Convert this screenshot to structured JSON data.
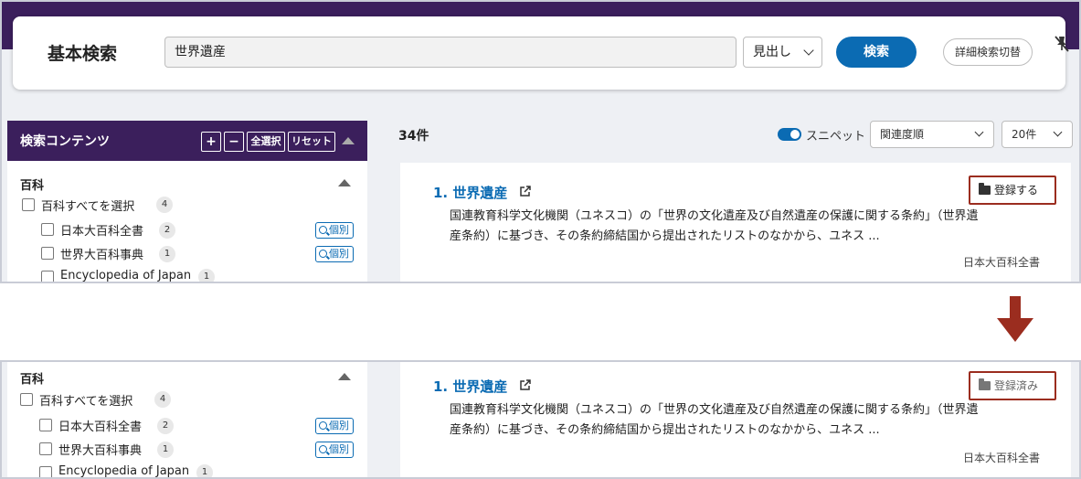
{
  "search": {
    "title": "基本検索",
    "query": "世界遺産",
    "mode": "見出し",
    "submit_label": "検索",
    "advanced_toggle_label": "詳細検索切替"
  },
  "sidebar": {
    "title": "検索コンテンツ",
    "plus_label": "+",
    "minus_label": "−",
    "select_all_label": "全選択",
    "reset_label": "リセット",
    "section_title": "百科",
    "select_all_item": {
      "label": "百科すべてを選択",
      "count": "4"
    },
    "items": [
      {
        "label": "日本大百科全書",
        "count": "2",
        "button": "個別"
      },
      {
        "label": "世界大百科事典",
        "count": "1",
        "button": "個別"
      },
      {
        "label": "Encyclopedia of Japan",
        "count": "1"
      }
    ]
  },
  "results": {
    "count_label": "34件",
    "snippet_toggle_label": "スニペット",
    "sort_value": "関連度順",
    "per_page_value": "20件"
  },
  "result_item": {
    "title": "1. 世界遺産",
    "snippet_line1": "国連教育科学文化機関（ユネスコ）の「世界の文化遺産及び自然遺産の保護に関する条約」（世界遺",
    "snippet_line2": "産条約）に基づき、その条約締結国から提出されたリストのなかから、ユネス ...",
    "snippet2_line1": "国連教育科学文化機関（ユネスコ）の「世界の文化遺産及び自然遺産の保護に関する条約」（世界遺",
    "snippet2_line2": "産条約）に基づき、その条約締結国から提出されたリストのなかから、ユネス ...",
    "source": "日本大百科全書",
    "register_label": "登録する",
    "registered_label": "登録済み"
  },
  "colors": {
    "brand_purple": "#3b1f5c",
    "link_blue": "#0b6bb3",
    "highlight_red": "#9b2d1f"
  }
}
